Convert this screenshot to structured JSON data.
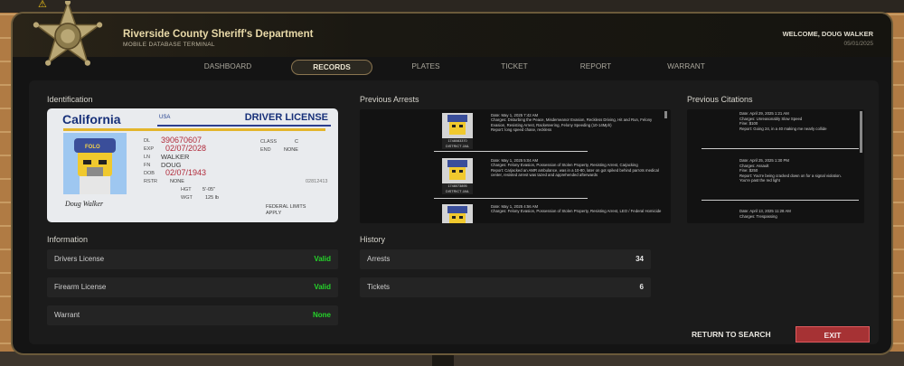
{
  "app": {
    "department": "Riverside County Sheriff's Department",
    "subtitle": "MOBILE DATABASE TERMINAL",
    "welcome": "WELCOME, DOUG WALKER",
    "date": "05/01/2025"
  },
  "tabs": [
    {
      "label": "DASHBOARD"
    },
    {
      "label": "RECORDS",
      "active": true
    },
    {
      "label": "PLATES"
    },
    {
      "label": "TICKET"
    },
    {
      "label": "REPORT"
    },
    {
      "label": "WARRANT"
    }
  ],
  "sections": {
    "identification": "Identification",
    "previous_arrests": "Previous Arrests",
    "previous_citations": "Previous Citations",
    "information": "Information",
    "history": "History"
  },
  "license": {
    "state": "California",
    "country": "USA",
    "type": "DRIVER LICENSE",
    "dl_label": "DL",
    "dl": "390670607",
    "exp_label": "EXP",
    "exp": "02/07/2028",
    "ln_label": "LN",
    "ln": "WALKER",
    "fn_label": "FN",
    "fn": "DOUG",
    "dob_label": "DOB",
    "dob": "02/07/1943",
    "rstr_label": "RSTR",
    "rstr": "NONE",
    "class_label": "CLASS",
    "class": "C",
    "end_label": "END",
    "end": "NONE",
    "hgt_label": "HGT",
    "hgt": "5'-05\"",
    "wgt_label": "WGT",
    "wgt": "125 lb",
    "doc_no": "02812413",
    "federal": "FEDERAL LIMITS APPLY",
    "signature": "Doug Walker",
    "cap_text": "FOLO"
  },
  "arrests": [
    {
      "date": "Date: May 1, 2025 7:42 AM",
      "charges": "Charges: Disturbing the Peace, Misdemeanor Evasion, Reckless Driving, Hit and Run, Felony Evasion, Resisting Arrest, Racketeering, Felony Speeding (10-14Mph)",
      "report": "Report: long speed chase, reckless",
      "tag": "1748083370 DISTRICT JAIL"
    },
    {
      "date": "Date: May 1, 2025 5:04 AM",
      "charges": "Charges: Felony Evasion, Possession of Stolen Property, Resisting Arrest, Carjacking",
      "report": "Report: Carjacked an AMR ambulance, was in a 10-80, later on got spiked behind parrots medical center, resisted arrest was tazed and apprehended afterwards",
      "tag": "1748073895 DISTRICT JAIL"
    },
    {
      "date": "Date: May 1, 2025 4:56 AM",
      "charges": "Charges: Felony Evasion, Possession of Stolen Property, Resisting Arrest, LEO / Federal Homicide",
      "report": "",
      "tag": ""
    }
  ],
  "citations": [
    {
      "date": "Date: April 29, 2025 1:21 AM",
      "charges": "Charges: Unreasonably Slow Speed",
      "fine": "Fine: $100",
      "report": "Report: Going 24, in a 40 making me nearly collide"
    },
    {
      "date": "Date: April 25, 2025 1:30 PM",
      "charges": "Charges: Assault",
      "fine": "Fine: $250",
      "report": "Report: You're being cracked down on for a signal violation. You're past the red light"
    },
    {
      "date": "Date: April 13, 2025 11:28 AM",
      "charges": "Charges: Trespassing",
      "fine": "",
      "report": ""
    }
  ],
  "information": [
    {
      "label": "Drivers License",
      "value": "Valid"
    },
    {
      "label": "Firearm License",
      "value": "Valid"
    },
    {
      "label": "Warrant",
      "value": "None"
    }
  ],
  "history": [
    {
      "label": "Arrests",
      "value": "34"
    },
    {
      "label": "Tickets",
      "value": "6"
    }
  ],
  "buttons": {
    "return": "RETURN TO SEARCH",
    "exit": "EXIT"
  },
  "colors": {
    "valid": "#25d32a",
    "exit": "#a63234",
    "accent": "#e8d9a8",
    "license_red": "#b12a3a"
  }
}
